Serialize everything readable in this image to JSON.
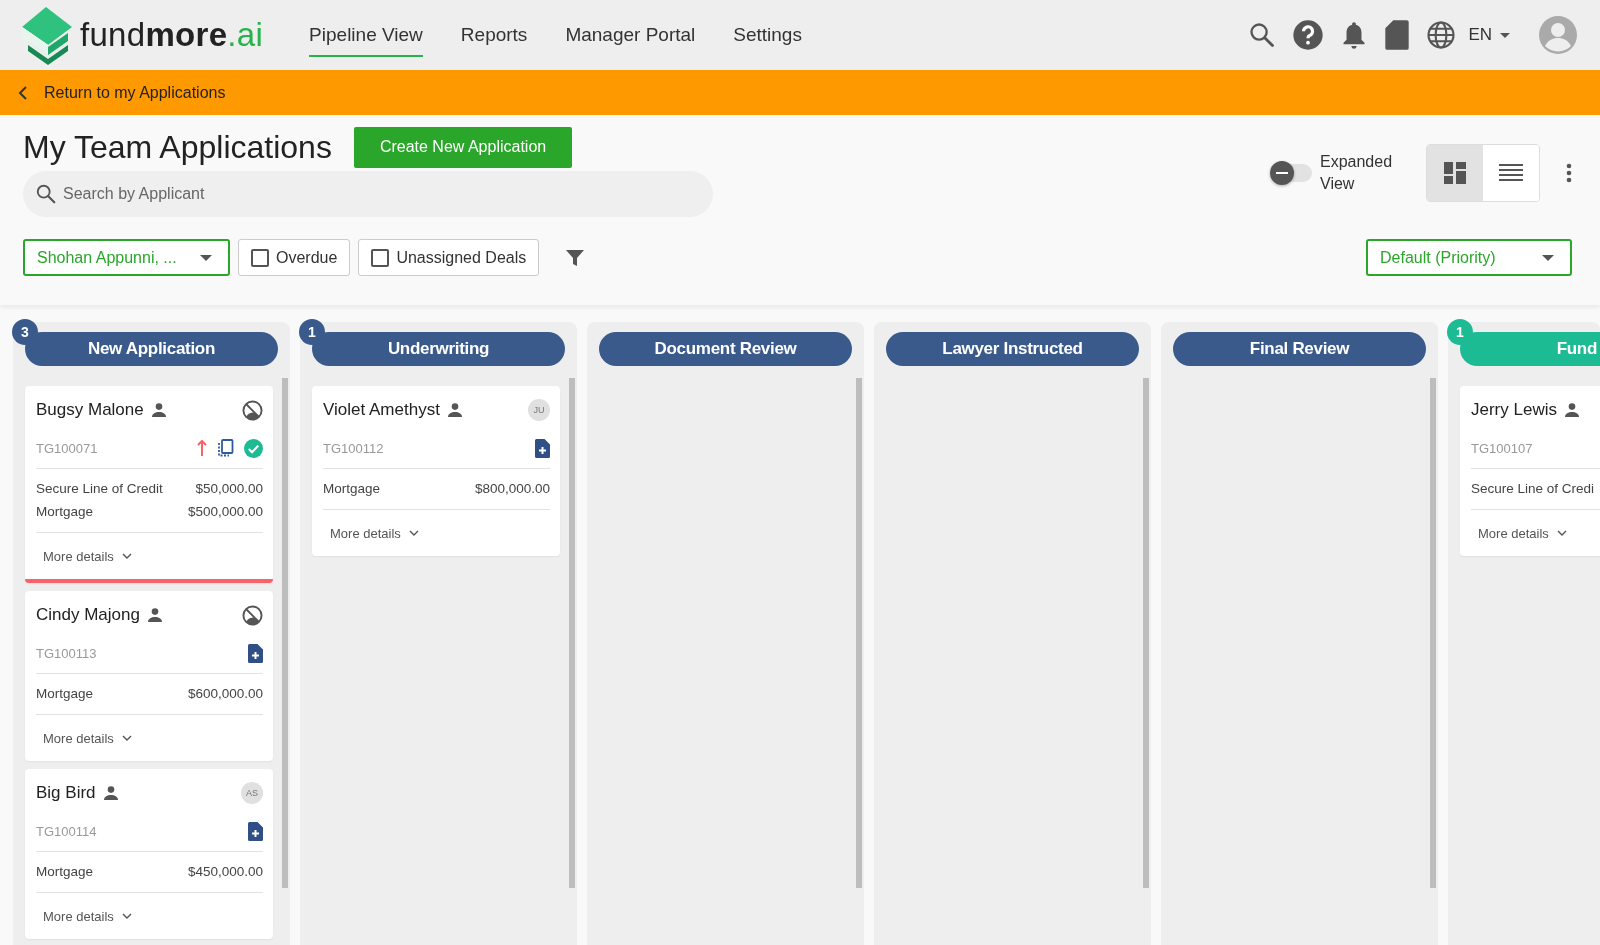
{
  "header": {
    "logo": {
      "light": "fund",
      "bold": "more",
      "suffix": ".ai"
    },
    "nav": [
      {
        "label": "Pipeline View",
        "selected": true
      },
      {
        "label": "Reports",
        "selected": false
      },
      {
        "label": "Manager Portal",
        "selected": false
      },
      {
        "label": "Settings",
        "selected": false
      }
    ],
    "language": "EN"
  },
  "back_bar": {
    "label": "Return to my Applications"
  },
  "page": {
    "title": "My Team Applications",
    "create_button": "Create New Application",
    "search": {
      "placeholder": "Search by Applicant"
    },
    "expanded_view": {
      "label": "Expanded View",
      "on": false
    },
    "view_modes": [
      {
        "kind": "board",
        "selected": true
      },
      {
        "kind": "list",
        "selected": false
      }
    ],
    "filters": {
      "owner": "Shohan Appunni, ...",
      "checkboxes": [
        {
          "label": "Overdue",
          "checked": false
        },
        {
          "label": "Unassigned Deals",
          "checked": false
        }
      ],
      "sort": "Default (Priority)"
    }
  },
  "columns": [
    {
      "title": "New Application",
      "count": "3",
      "color": "#3a5a8c",
      "cards": [
        {
          "name": "Bugsy Malone",
          "id": "TG100071",
          "flagged": true,
          "status": {
            "kind": "blocked"
          },
          "icons": [
            {
              "kind": "arrow-up"
            },
            {
              "kind": "copy"
            },
            {
              "kind": "check"
            }
          ],
          "products": [
            {
              "name": "Secure Line of Credit",
              "amount": "$50,000.00"
            },
            {
              "name": "Mortgage",
              "amount": "$500,000.00"
            }
          ],
          "more": "More details"
        },
        {
          "name": "Cindy Majong",
          "id": "TG100113",
          "flagged": false,
          "status": {
            "kind": "blocked"
          },
          "icons": [
            {
              "kind": "doc-plus"
            }
          ],
          "products": [
            {
              "name": "Mortgage",
              "amount": "$600,000.00"
            }
          ],
          "more": "More details"
        },
        {
          "name": "Big Bird",
          "id": "TG100114",
          "flagged": false,
          "status": {
            "kind": "avatar",
            "initials": "AS"
          },
          "icons": [
            {
              "kind": "doc-plus"
            }
          ],
          "products": [
            {
              "name": "Mortgage",
              "amount": "$450,000.00"
            }
          ],
          "more": "More details"
        }
      ]
    },
    {
      "title": "Underwriting",
      "count": "1",
      "color": "#3a5a8c",
      "cards": [
        {
          "name": "Violet Amethyst",
          "id": "TG100112",
          "flagged": false,
          "status": {
            "kind": "avatar",
            "initials": "JU"
          },
          "icons": [
            {
              "kind": "doc-plus"
            }
          ],
          "products": [
            {
              "name": "Mortgage",
              "amount": "$800,000.00"
            }
          ],
          "more": "More details"
        }
      ]
    },
    {
      "title": "Document Review",
      "color": "#3a5a8c"
    },
    {
      "title": "Lawyer Instructed",
      "color": "#3a5a8c"
    },
    {
      "title": "Final Review",
      "color": "#3a5a8c"
    },
    {
      "title": "Fund",
      "count": "1",
      "color": "#1dbb94",
      "cards": [
        {
          "name": "Jerry Lewis",
          "id": "TG100107",
          "flagged": false,
          "products": [
            {
              "name": "Secure Line of Credi"
            }
          ],
          "more": "More details"
        }
      ]
    }
  ]
}
